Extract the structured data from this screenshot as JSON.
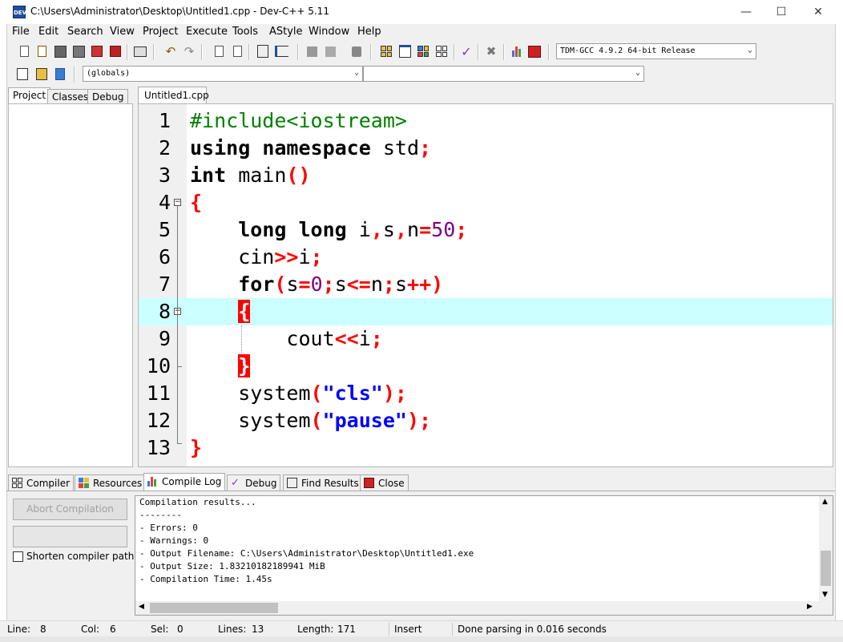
{
  "window": {
    "title": "C:\\Users\\Administrator\\Desktop\\Untitled1.cpp - Dev-C++ 5.11",
    "app_icon_text": "DEV",
    "minimize": "—",
    "maximize": "☐",
    "close": "✕"
  },
  "menu": [
    "File",
    "Edit",
    "Search",
    "View",
    "Project",
    "Execute",
    "Tools",
    "AStyle",
    "Window",
    "Help"
  ],
  "toolbar": {
    "compiler_select": "TDM-GCC 4.9.2 64-bit Release",
    "scope_select": "(globals)",
    "member_select": ""
  },
  "left_panel": {
    "tabs": [
      "Project",
      "Classes",
      "Debug"
    ],
    "active_tab": "Project"
  },
  "editor": {
    "tab": "Untitled1.cpp",
    "active_line": 8,
    "line_numbers": [
      "1",
      "2",
      "3",
      "4",
      "5",
      "6",
      "7",
      "8",
      "9",
      "10",
      "11",
      "12",
      "13"
    ]
  },
  "bottom_panel": {
    "tabs": [
      "Compiler",
      "Resources",
      "Compile Log",
      "Debug",
      "Find Results",
      "Close"
    ],
    "active_tab": "Compile Log",
    "abort_button": "Abort Compilation",
    "shorten_checkbox": "Shorten compiler paths",
    "log": [
      "Compilation results...",
      "--------",
      "- Errors: 0",
      "- Warnings: 0",
      "- Output Filename: C:\\Users\\Administrator\\Desktop\\Untitled1.exe",
      "- Output Size: 1.83210182189941 MiB",
      "- Compilation Time: 1.45s"
    ]
  },
  "status": {
    "line_label": "Line:",
    "line_value": "8",
    "col_label": "Col:",
    "col_value": "6",
    "sel_label": "Sel:",
    "sel_value": "0",
    "lines_label": "Lines:",
    "lines_value": "13",
    "length_label": "Length:",
    "length_value": "171",
    "mode": "Insert",
    "message": "Done parsing in 0.016 seconds"
  },
  "colors": {
    "active_line": "#ccffff",
    "keyword": "#000000",
    "preprocessor": "#008000",
    "symbol": "#ff0000",
    "number": "#800080",
    "string": "#0000ff"
  }
}
